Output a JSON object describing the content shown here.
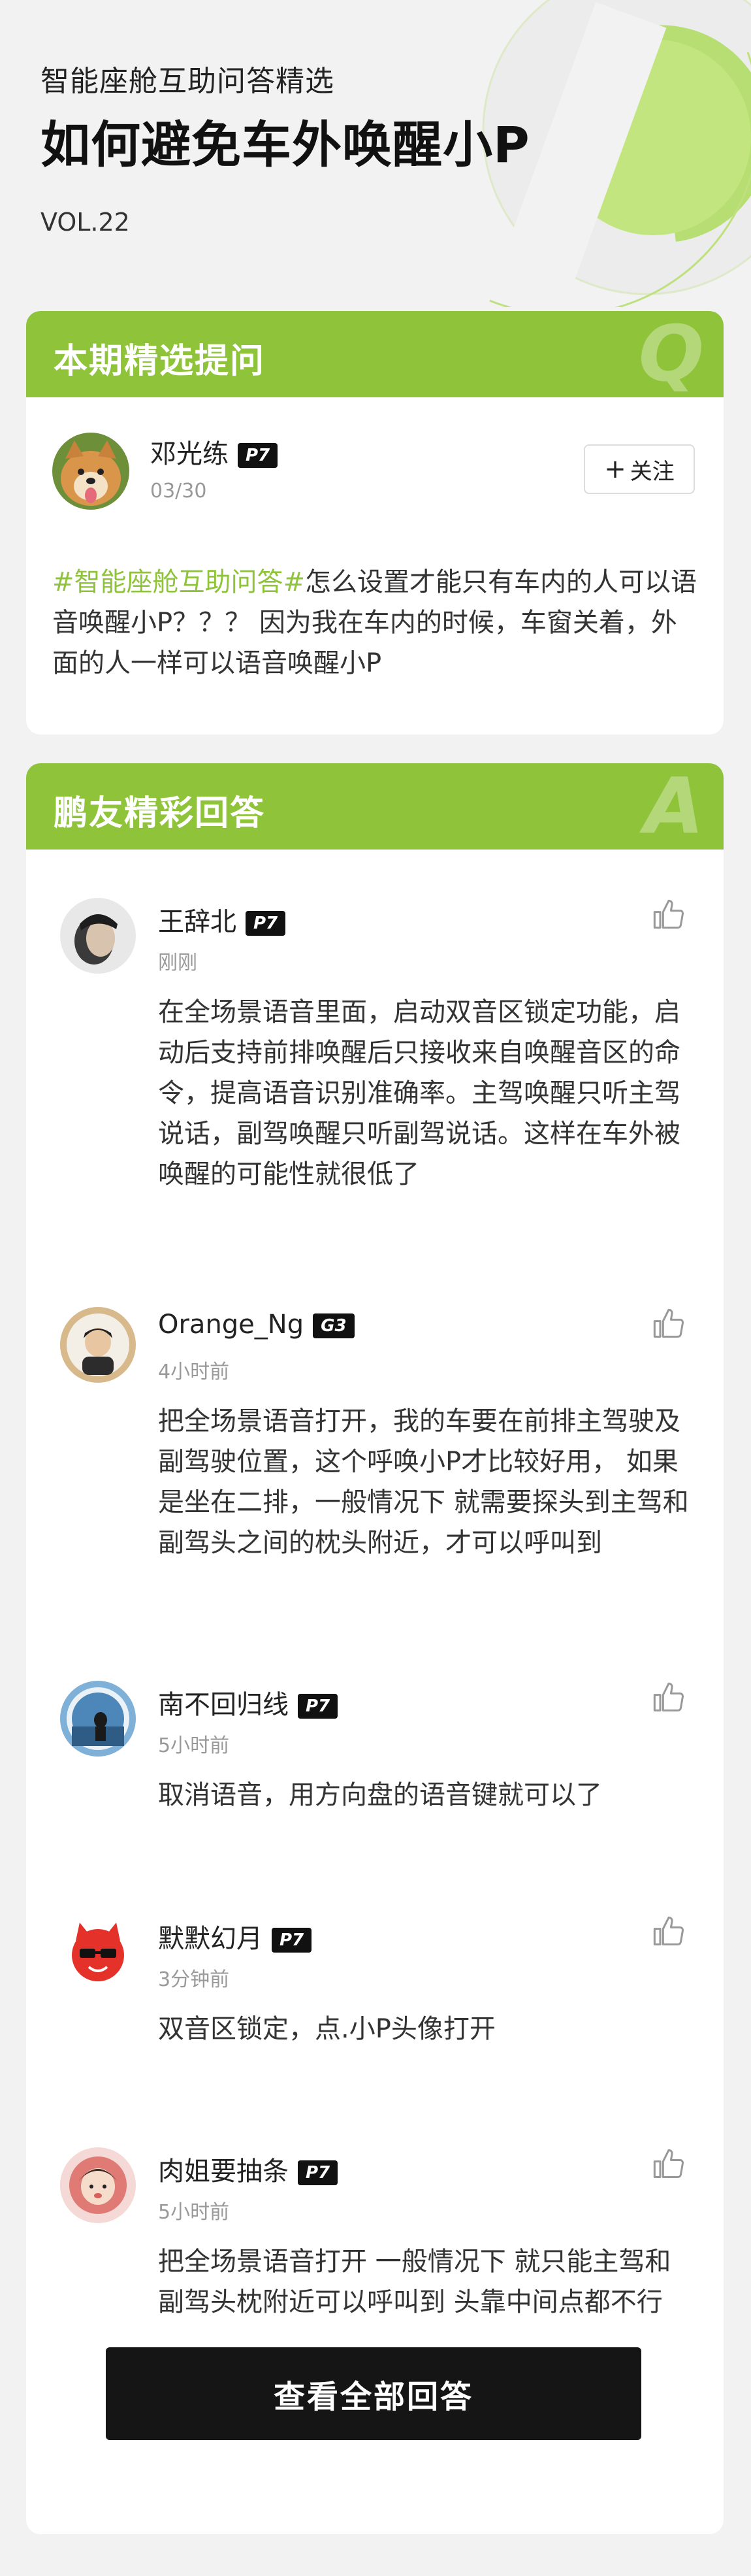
{
  "hero": {
    "subtitle": "智能座舱互助问答精选",
    "title": "如何避免车外唤醒小P",
    "vol": "VOL.22",
    "accent_color": "#8fc43a"
  },
  "question_card": {
    "header": "本期精选提问",
    "header_letter": "Q",
    "user": {
      "name": "邓光练",
      "badge": "P7",
      "time": "03/30",
      "avatar_icon": "shiba-dog-avatar"
    },
    "follow_label": "关注",
    "follow_icon": "plus-icon",
    "hashtag": "#智能座舱互助问答#",
    "text": "怎么设置才能只有车内的人可以语音唤醒小P？？？ 因为我在车内的时候，车窗关着，外面的人一样可以语音唤醒小P"
  },
  "answer_card": {
    "header": "鹏友精彩回答",
    "header_letter": "A",
    "answers": [
      {
        "name": "王辞北",
        "badge": "P7",
        "time": "刚刚",
        "text": "在全场景语音里面，启动双音区锁定功能，启动后支持前排唤醒后只接收来自唤醒音区的命令，提高语音识别准确率。主驾唤醒只听主驾说话，副驾唤醒只听副驾说话。这样在车外被唤醒的可能性就很低了"
      },
      {
        "name": "Orange_Ng",
        "badge": "G3",
        "time": "4小时前",
        "text": "把全场景语音打开，我的车要在前排主驾驶及副驾驶位置，这个呼唤小P才比较好用， 如果是坐在二排，一般情况下 就需要探头到主驾和副驾头之间的枕头附近，才可以呼叫到"
      },
      {
        "name": "南不回归线",
        "badge": "P7",
        "time": "5小时前",
        "text": "取消语音，用方向盘的语音键就可以了"
      },
      {
        "name": "默默幻月",
        "badge": "P7",
        "time": "3分钟前",
        "text": "双音区锁定，点.小P头像打开"
      },
      {
        "name": "肉姐要抽条",
        "badge": "P7",
        "time": "5小时前",
        "text": "把全场景语音打开 一般情况下 就只能主驾和副驾头枕附近可以呼叫到 头靠中间点都不行"
      }
    ],
    "like_icon": "thumbs-up-icon",
    "view_all_label": "查看全部回答"
  }
}
